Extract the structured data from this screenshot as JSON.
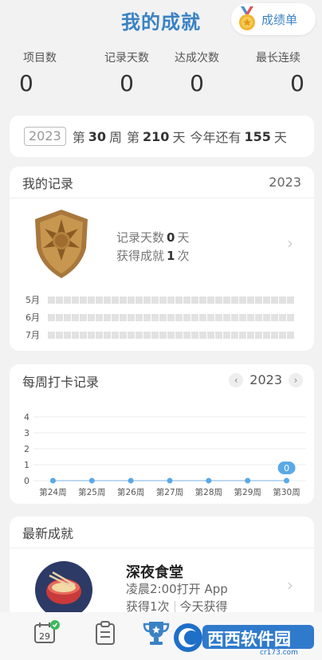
{
  "header": {
    "title": "我的成就",
    "report_button": "成绩单"
  },
  "stats": [
    {
      "label": "项目数",
      "value": "0"
    },
    {
      "label": "记录天数",
      "value": "0"
    },
    {
      "label": "达成次数",
      "value": "0"
    },
    {
      "label": "最长连续",
      "value": "0"
    }
  ],
  "week_bar": {
    "year": "2023",
    "w_prefix": "第",
    "week": "30",
    "w_suffix": "周",
    "d_prefix": "第",
    "day": "210",
    "d_suffix": "天",
    "r_prefix": "今年还有",
    "remaining": "155",
    "r_suffix": "天"
  },
  "records": {
    "title": "我的记录",
    "year": "2023",
    "days_label": "记录天数",
    "days_value": "0",
    "days_unit": "天",
    "ach_label": "获得成就",
    "ach_value": "1",
    "ach_unit": "次",
    "months": [
      "5月",
      "6月",
      "7月"
    ]
  },
  "weekly": {
    "title": "每周打卡记录",
    "year": "2023"
  },
  "chart_data": {
    "type": "line",
    "categories": [
      "第24周",
      "第25周",
      "第26周",
      "第27周",
      "第28周",
      "第29周",
      "第30周"
    ],
    "series": [
      {
        "values": [
          0,
          0,
          0,
          0,
          0,
          0,
          0
        ]
      }
    ],
    "yticks": [
      "0",
      "1",
      "2",
      "3",
      "4"
    ],
    "ylim": [
      0,
      4
    ],
    "highlight_label": "0",
    "accent": "#5aa9e6"
  },
  "latest": {
    "title": "最新成就",
    "name": "深夜食堂",
    "desc": "凌晨2:00打开 App",
    "count": "获得1次",
    "when": "今天获得"
  },
  "tabbar": {
    "calendar_day": "29"
  },
  "watermark": {
    "text": "西西软件园",
    "sub": "cr173.com"
  },
  "colors": {
    "accent": "#3b82c4",
    "background": "#f2f2f3"
  }
}
